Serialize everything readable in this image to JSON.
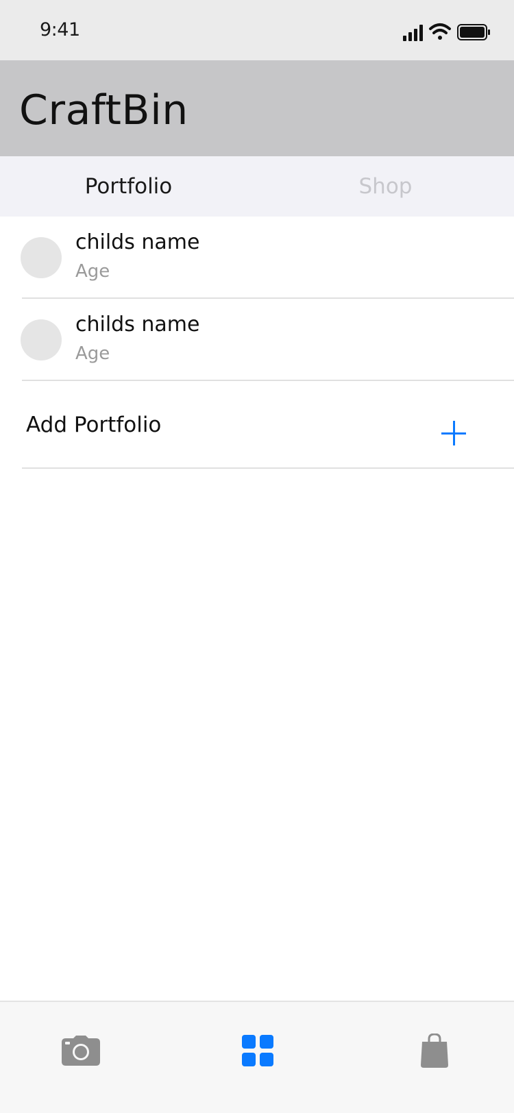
{
  "status": {
    "time": "9:41"
  },
  "header": {
    "title": "CraftBin"
  },
  "segments": [
    {
      "label": "Portfolio",
      "active": true
    },
    {
      "label": "Shop",
      "active": false
    }
  ],
  "portfolios": [
    {
      "name": "childs name",
      "age": "Age"
    },
    {
      "name": "childs name",
      "age": "Age"
    }
  ],
  "add_portfolio": {
    "label": "Add Portfolio",
    "icon": "plus-icon"
  },
  "tab_bar": {
    "items": [
      {
        "icon": "camera-icon",
        "active": false
      },
      {
        "icon": "grid-icon",
        "active": true
      },
      {
        "icon": "shopping-bag-icon",
        "active": false
      }
    ]
  },
  "colors": {
    "accent": "#0a7aff",
    "inactive_icon": "#8e8e8e",
    "header_bg": "#c6c6c8",
    "segment_bg": "#f2f2f7"
  }
}
